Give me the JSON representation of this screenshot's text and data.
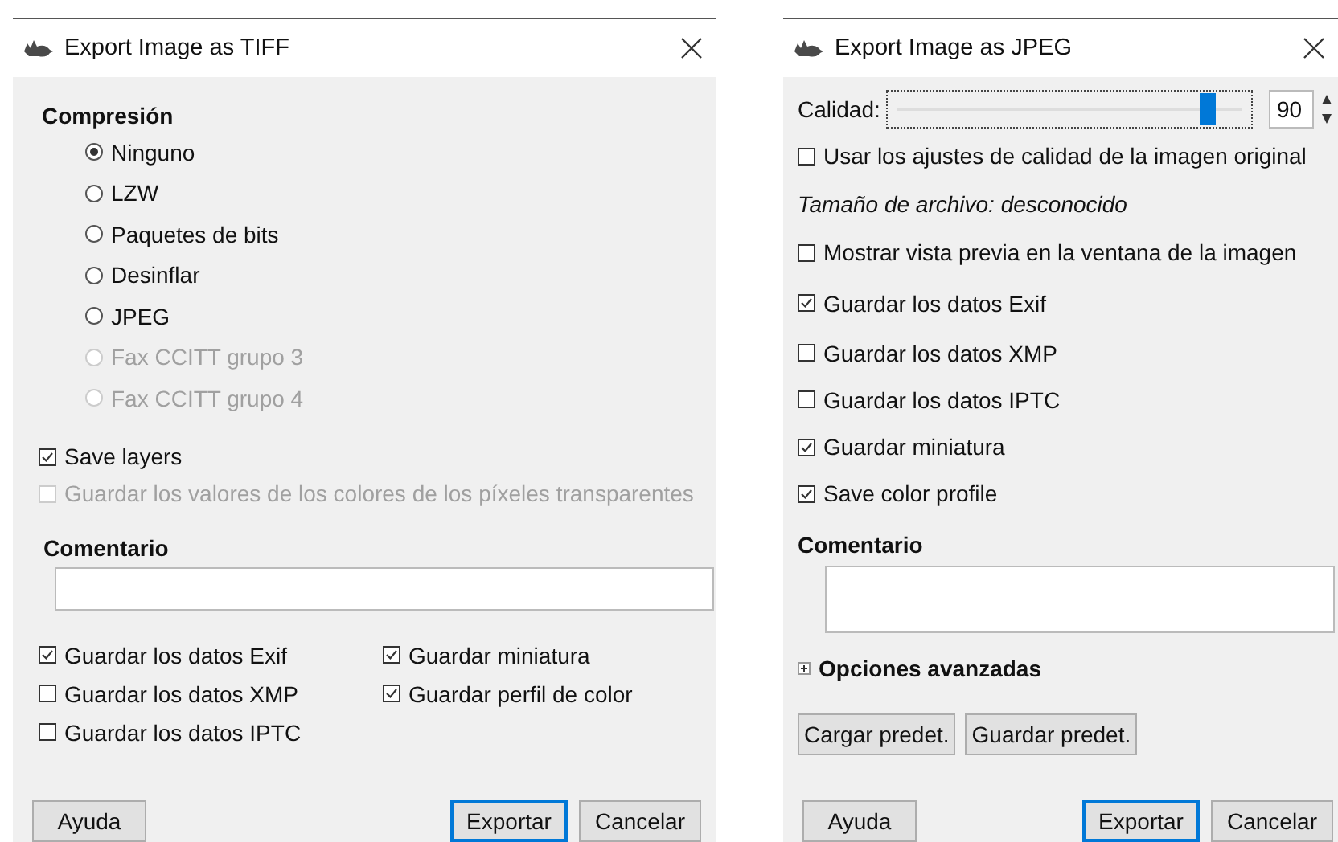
{
  "tiff_dialog": {
    "title": "Export Image as TIFF",
    "compression": {
      "heading": "Compresión",
      "options": [
        {
          "label": "Ninguno",
          "selected": true,
          "disabled": false
        },
        {
          "label": "LZW",
          "selected": false,
          "disabled": false
        },
        {
          "label": "Paquetes de bits",
          "selected": false,
          "disabled": false
        },
        {
          "label": "Desinflar",
          "selected": false,
          "disabled": false
        },
        {
          "label": "JPEG",
          "selected": false,
          "disabled": false
        },
        {
          "label": "Fax CCITT grupo 3",
          "selected": false,
          "disabled": true
        },
        {
          "label": "Fax CCITT grupo 4",
          "selected": false,
          "disabled": true
        }
      ]
    },
    "options": [
      {
        "label": "Save layers",
        "checked": true,
        "disabled": false
      },
      {
        "label": "Guardar los valores de los colores de los píxeles transparentes",
        "checked": false,
        "disabled": true
      }
    ],
    "comment_heading": "Comentario",
    "metadata": [
      {
        "label": "Guardar los datos Exif",
        "checked": true
      },
      {
        "label": "Guardar los datos XMP",
        "checked": false
      },
      {
        "label": "Guardar los datos IPTC",
        "checked": false
      },
      {
        "label": "Guardar miniatura",
        "checked": true
      },
      {
        "label": "Guardar perfil de color",
        "checked": true
      }
    ],
    "buttons": [
      {
        "label": "Ayuda",
        "focused": false
      },
      {
        "label": "Exportar",
        "focused": true
      },
      {
        "label": "Cancelar",
        "focused": false
      }
    ]
  },
  "jpeg_dialog": {
    "title": "Export Image as JPEG",
    "quality": {
      "label": "Calidad:",
      "level": 0.9,
      "value": "90"
    },
    "items": [
      {
        "kind": "checkbox",
        "label": "Usar los ajustes de calidad de la imagen original",
        "checked": false
      },
      {
        "kind": "info",
        "label": "Tamaño de archivo: desconocido"
      },
      {
        "kind": "checkbox",
        "label": "Mostrar vista previa en la ventana de la imagen",
        "checked": false
      },
      {
        "kind": "checkbox",
        "label": "Guardar los datos Exif",
        "checked": true
      },
      {
        "kind": "checkbox",
        "label": "Guardar los datos XMP",
        "checked": false
      },
      {
        "kind": "checkbox",
        "label": "Guardar los datos IPTC",
        "checked": false
      },
      {
        "kind": "checkbox",
        "label": "Guardar miniatura",
        "checked": true
      },
      {
        "kind": "checkbox",
        "label": "Save color profile",
        "checked": true
      }
    ],
    "comment_heading": "Comentario",
    "advanced": {
      "label": "Opciones avanzadas",
      "expanded": false
    },
    "preset_buttons": [
      "Cargar predet.",
      "Guardar predet."
    ],
    "buttons": [
      {
        "label": "Ayuda",
        "focused": false
      },
      {
        "label": "Exportar",
        "focused": true
      },
      {
        "label": "Cancelar",
        "focused": false
      }
    ]
  }
}
